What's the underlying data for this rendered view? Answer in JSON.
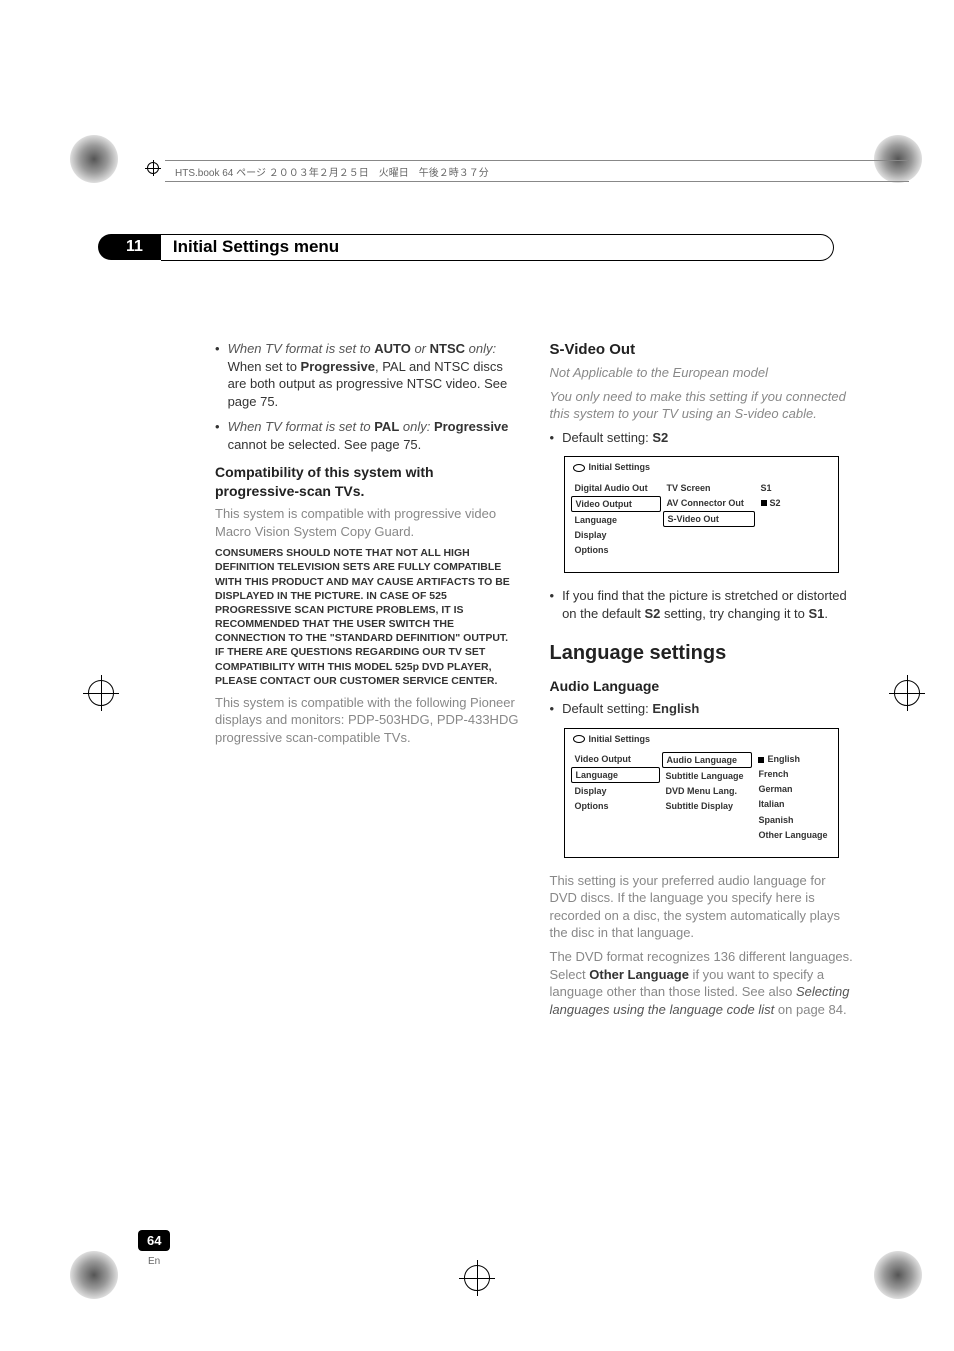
{
  "header": {
    "book_info": "HTS.book  64 ページ  ２００３年２月２５日　火曜日　午後２時３７分"
  },
  "chapter": {
    "number": "11",
    "title": "Initial Settings menu"
  },
  "left_column": {
    "bullet1_prefix": "When TV format is set to ",
    "bullet1_auto": "AUTO",
    "bullet1_or": " or ",
    "bullet1_ntsc": "NTSC",
    "bullet1_only": " only:",
    "bullet1_rest1": " When set to ",
    "bullet1_prog": "Progressive",
    "bullet1_rest2": ", PAL and NTSC discs are both output as progressive NTSC video. See page 75.",
    "bullet2_prefix": "When TV format is set to ",
    "bullet2_pal": "PAL",
    "bullet2_only": " only: ",
    "bullet2_prog": "Progressive",
    "bullet2_rest": " cannot be selected. See page 75.",
    "compat_heading": "Compatibility of this system with progressive-scan TVs.",
    "compat_p1": "This system is compatible with progressive video Macro Vision System Copy Guard.",
    "compat_note": "CONSUMERS SHOULD NOTE THAT NOT ALL HIGH DEFINITION TELEVISION SETS ARE FULLY COMPATIBLE WITH THIS PRODUCT AND MAY CAUSE ARTIFACTS TO BE DISPLAYED IN THE PICTURE. IN CASE OF 525 PROGRESSIVE SCAN PICTURE PROBLEMS, IT IS RECOMMENDED THAT THE USER SWITCH THE CONNECTION TO THE \"STANDARD DEFINITION\" OUTPUT. IF THERE ARE QUESTIONS REGARDING OUR TV SET COMPATIBILITY WITH THIS MODEL 525p DVD PLAYER, PLEASE CONTACT OUR CUSTOMER SERVICE CENTER.",
    "compat_p2": "This system is compatible with the following Pioneer displays and monitors: PDP-503HDG, PDP-433HDG progressive scan-compatible TVs."
  },
  "right_column": {
    "svideo_heading": "S-Video Out",
    "svideo_note1": "Not Applicable to the European model",
    "svideo_note2": "You only need to make this setting if you connected this system to your TV using an S-video cable.",
    "svideo_default_label": "Default setting: ",
    "svideo_default_value": "S2",
    "osd1": {
      "title": "Initial Settings",
      "col1": [
        "Digital Audio Out",
        "Video Output",
        "Language",
        "Display",
        "Options"
      ],
      "col2": [
        "TV Screen",
        "AV Connector Out",
        "S-Video Out"
      ],
      "col3": [
        "S1",
        "S2"
      ],
      "col1_selected": 1,
      "col2_selected": 2,
      "col3_selected": 1
    },
    "svideo_bullet_a": "If you find that the picture is stretched or distorted on the default ",
    "svideo_bullet_s2": "S2",
    "svideo_bullet_b": " setting, try changing it to ",
    "svideo_bullet_s1": "S1",
    "svideo_bullet_c": ".",
    "lang_section": "Language settings",
    "audio_heading": "Audio Language",
    "audio_default_label": "Default setting: ",
    "audio_default_value": "English",
    "osd2": {
      "title": "Initial Settings",
      "col1": [
        "Video Output",
        "Language",
        "Display",
        "Options"
      ],
      "col2": [
        "Audio Language",
        "Subtitle Language",
        "DVD Menu Lang.",
        "Subtitle Display"
      ],
      "col3": [
        "English",
        "French",
        "German",
        "Italian",
        "Spanish",
        "Other Language"
      ],
      "col1_selected": 1,
      "col2_selected": 0,
      "col3_selected": 0
    },
    "audio_p1": "This setting is your preferred audio language for DVD discs. If the language you specify here is recorded on a disc, the system automatically plays the disc in that language.",
    "audio_p2a": "The DVD format recognizes 136 different languages. Select ",
    "audio_p2_other": "Other Language",
    "audio_p2b": " if you want to specify a language other than those listed. See also ",
    "audio_p2_ref": "Selecting languages using the language code list",
    "audio_p2c": " on page 84."
  },
  "page": {
    "number": "64",
    "lang": "En"
  }
}
